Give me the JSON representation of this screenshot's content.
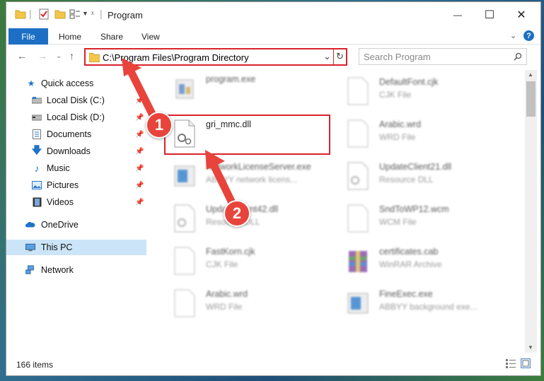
{
  "window": {
    "title": "Program",
    "controls": {
      "minimize": "—",
      "maximize": "☐",
      "close": "✕"
    }
  },
  "ribbon": {
    "file_label": "File",
    "tabs": [
      "Home",
      "Share",
      "View"
    ]
  },
  "address": {
    "path": "C:\\Program Files\\Program Directory",
    "search_placeholder": "Search Program"
  },
  "sidebar": {
    "items": [
      {
        "label": "Quick access",
        "icon": "star-icon",
        "pinned": false
      },
      {
        "label": "Local Disk (C:)",
        "icon": "drive-icon",
        "pinned": true
      },
      {
        "label": "Local Disk (D:)",
        "icon": "drive-icon",
        "pinned": true
      },
      {
        "label": "Documents",
        "icon": "documents-icon",
        "pinned": true
      },
      {
        "label": "Downloads",
        "icon": "download-icon",
        "pinned": true
      },
      {
        "label": "Music",
        "icon": "music-icon",
        "pinned": true
      },
      {
        "label": "Pictures",
        "icon": "pictures-icon",
        "pinned": true
      },
      {
        "label": "Videos",
        "icon": "videos-icon",
        "pinned": true
      },
      {
        "label": "OneDrive",
        "icon": "cloud-icon",
        "pinned": false
      },
      {
        "label": "This PC",
        "icon": "computer-icon",
        "pinned": false,
        "selected": true
      },
      {
        "label": "Network",
        "icon": "network-icon",
        "pinned": false
      }
    ]
  },
  "files": {
    "left": [
      {
        "name": "program.exe",
        "type": ""
      },
      {
        "name": "gri_mmc.dll",
        "type": ""
      },
      {
        "name": "NetworkLicenseServer.exe",
        "type": "ABBYY network licens..."
      },
      {
        "name": "UpdateClient42.dll",
        "type": "Resource DLL"
      },
      {
        "name": "FastKorn.cjk",
        "type": "CJK File"
      },
      {
        "name": "Arabic.wrd",
        "type": "WRD File"
      }
    ],
    "right": [
      {
        "name": "DefaultFont.cjk",
        "type": "CJK File"
      },
      {
        "name": "Arabic.wrd",
        "type": "WRD File"
      },
      {
        "name": "UpdateClient21.dll",
        "type": "Resource DLL"
      },
      {
        "name": "SndToWP12.wcm",
        "type": "WCM File"
      },
      {
        "name": "certificates.cab",
        "type": "WinRAR Archive"
      },
      {
        "name": "FineExec.exe",
        "type": "ABBYY background exe..."
      }
    ]
  },
  "status": {
    "item_count": "166 items"
  },
  "annotations": {
    "step1": "1",
    "step2": "2",
    "color": "#e8443c"
  }
}
